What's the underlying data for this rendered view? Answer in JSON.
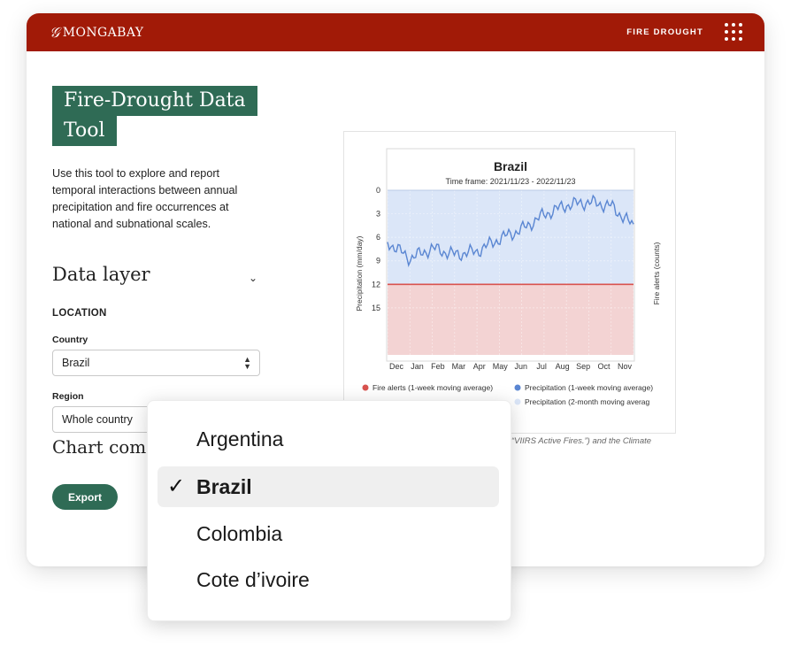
{
  "header": {
    "logo_text": "MONGABAY",
    "nav_link": "FIRE DROUGHT",
    "menu_icon": "apps-grid-icon"
  },
  "sidebar": {
    "title_line1": "Fire-Drought Data",
    "title_line2": "Tool",
    "intro": "Use this tool to explore and report temporal interactions between annual precipitation and fire occurrences at national and subnational scales.",
    "data_layer_heading": "Data layer",
    "location_label": "LOCATION",
    "country_label": "Country",
    "country_value": "Brazil",
    "region_label": "Region",
    "region_value": "Whole country",
    "chart_heading": "Chart com",
    "export_label": "Export"
  },
  "chart_data": {
    "type": "line",
    "title": "Brazil",
    "subtitle": "Time frame: 2021/11/23 - 2022/11/23",
    "ylabel": "Precipitation (mm/day)",
    "y2label": "Fire alerts (counts)",
    "ylim": [
      0,
      21
    ],
    "y_inverted": true,
    "y_ticks": [
      "0",
      "3",
      "6",
      "9",
      "12",
      "15"
    ],
    "categories": [
      "Dec",
      "Jan",
      "Feb",
      "Mar",
      "Apr",
      "May",
      "Jun",
      "Jul",
      "Aug",
      "Sep",
      "Oct",
      "Nov"
    ],
    "series": [
      {
        "name": "Precipitation (1-week moving average)",
        "color": "#5a86d2",
        "values": [
          6.6,
          8.7,
          7.4,
          8.2,
          7.8,
          6.2,
          5.0,
          3.1,
          1.9,
          1.5,
          2.0,
          4.6
        ]
      },
      {
        "name": "Precipitation (2-month moving averag",
        "color": "#dbe6f8"
      },
      {
        "name": "Fire alerts (1-week moving average)",
        "color": "#d9534f",
        "values": [
          12,
          12,
          12,
          12,
          12,
          12,
          12,
          12,
          12,
          12,
          12,
          12
        ]
      }
    ],
    "legend": [
      {
        "label": "Fire alerts (1-week moving average)",
        "color": "#d9534f"
      },
      {
        "label": "Precipitation (1-week moving average)",
        "color": "#5a86d2"
      },
      {
        "label": "Precipitation (2-month moving averag",
        "color": "#dbe6f8"
      }
    ],
    "caption": "“VIIRS Active Fires.”) and the Climate"
  },
  "dropdown": {
    "options": [
      {
        "label": "Argentina",
        "selected": false
      },
      {
        "label": "Brazil",
        "selected": true
      },
      {
        "label": "Colombia",
        "selected": false
      },
      {
        "label": "Cote d’ivoire",
        "selected": false
      }
    ],
    "check_glyph": "✓"
  }
}
